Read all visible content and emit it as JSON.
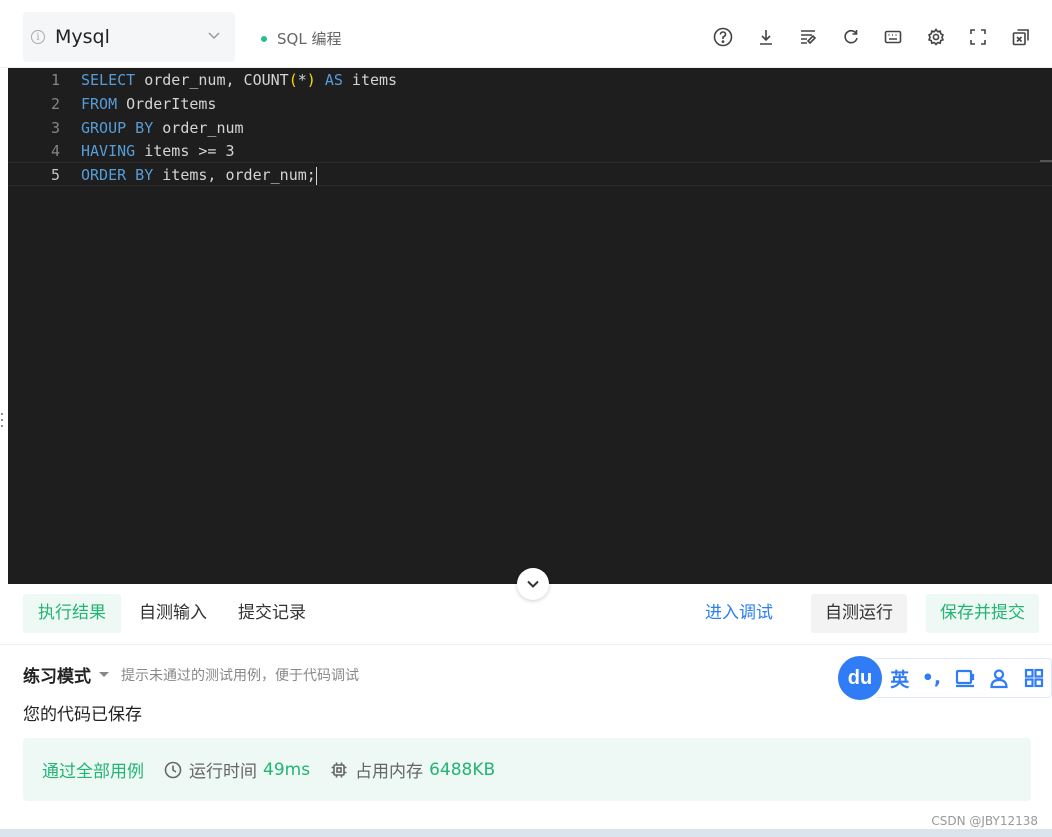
{
  "toolbar": {
    "language": "Mysql",
    "mode": "SQL 编程",
    "info_icon": "info-icon",
    "icons": [
      "help-icon",
      "download-icon",
      "format-icon",
      "refresh-icon",
      "keyboard-icon",
      "settings-icon",
      "fullscreen-icon",
      "popout-icon"
    ]
  },
  "editor": {
    "lines": [
      {
        "no": "1",
        "text": "SELECT order_num, COUNT(*) AS items"
      },
      {
        "no": "2",
        "text": "FROM OrderItems"
      },
      {
        "no": "3",
        "text": "GROUP BY order_num"
      },
      {
        "no": "4",
        "text": "HAVING items >= 3"
      },
      {
        "no": "5",
        "text": "ORDER BY items, order_num;"
      }
    ],
    "tokens": {
      "l1": [
        "SELECT",
        " order_num, COUNT",
        "(",
        "*",
        ")",
        " ",
        "AS",
        " items"
      ],
      "l2": [
        "FROM",
        " OrderItems"
      ],
      "l3": [
        "GROUP BY",
        " order_num"
      ],
      "l4": [
        "HAVING",
        " items >= 3"
      ],
      "l5": [
        "ORDER BY",
        " items, order_num;"
      ]
    }
  },
  "panel": {
    "tabs": [
      "执行结果",
      "自测输入",
      "提交记录"
    ],
    "debug_label": "进入调试",
    "run_label": "自测运行",
    "submit_label": "保存并提交",
    "practice_title": "练习模式",
    "practice_hint": "提示未通过的测试用例，便于代码调试",
    "saved_message": "您的代码已保存",
    "result": {
      "pass_label": "通过全部用例",
      "runtime_label": "运行时间",
      "runtime_value": "49ms",
      "memory_label": "占用内存",
      "memory_value": "6488KB"
    }
  },
  "ime": {
    "logo": "du",
    "lang": "英",
    "punct": "•,"
  },
  "watermark": "CSDN @JBY12138",
  "colors": {
    "accent_green": "#22b573",
    "link_blue": "#2d7ff0",
    "editor_bg": "#1e1e1e",
    "keyword": "#569cd6"
  }
}
